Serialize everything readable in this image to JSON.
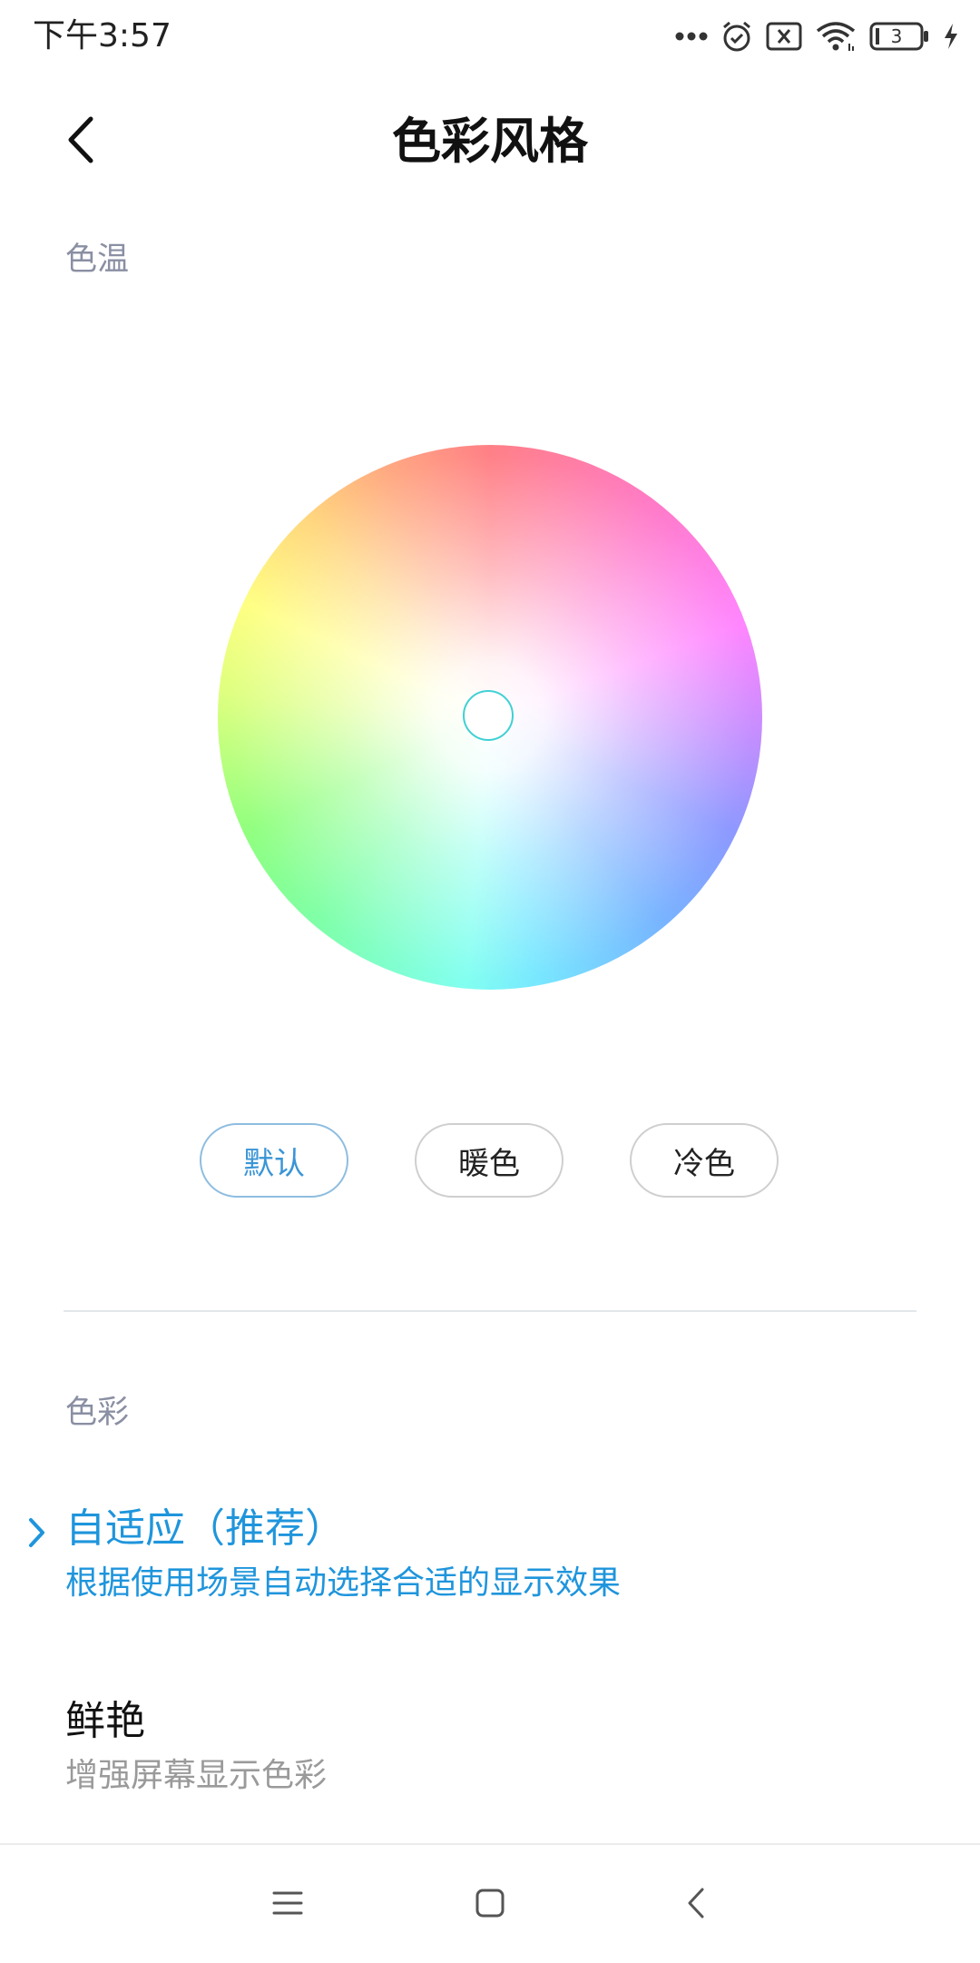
{
  "status_bar": {
    "time": "下午3:57",
    "battery_level": "3",
    "icons": [
      "more-dots-icon",
      "alarm-icon",
      "sim-off-icon",
      "wifi-icon",
      "battery-icon",
      "charging-icon"
    ]
  },
  "header": {
    "title": "色彩风格",
    "back_icon": "chevron-left-icon"
  },
  "color_temperature": {
    "section_label": "色温",
    "presets": [
      {
        "label": "默认",
        "selected": true
      },
      {
        "label": "暖色",
        "selected": false
      },
      {
        "label": "冷色",
        "selected": false
      }
    ]
  },
  "color_mode": {
    "section_label": "色彩",
    "options": [
      {
        "title": "自适应（推荐）",
        "description": "根据使用场景自动选择合适的显示效果",
        "selected": true
      },
      {
        "title": "鲜艳",
        "description": "增强屏幕显示色彩",
        "selected": false
      }
    ]
  },
  "nav_bar": {
    "icons": [
      "menu-icon",
      "home-icon",
      "back-icon"
    ]
  },
  "colors": {
    "accent": "#1f95dc",
    "section_label": "#8a8fa3",
    "selected_preset_text": "#3a95d6",
    "wheel_handle_border": "#3fd0d4"
  }
}
